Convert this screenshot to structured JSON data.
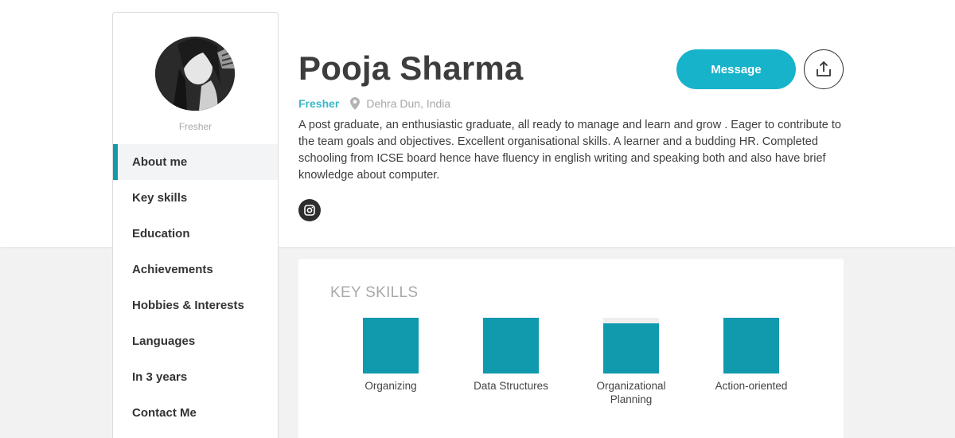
{
  "profile": {
    "name": "Pooja Sharma",
    "role": "Fresher",
    "location": "Dehra Dun, India",
    "bio": "A post graduate, an enthusiastic graduate, all ready to manage and learn and grow . Eager to contribute to the team goals and objectives. Excellent organisational skills. A learner and a budding HR. Completed schooling from ICSE board hence have fluency in english writing and speaking both and also have brief knowledge about computer.",
    "message_label": "Message"
  },
  "sidebar": {
    "role": "Fresher",
    "items": [
      {
        "label": "About me",
        "active": true
      },
      {
        "label": "Key skills",
        "active": false
      },
      {
        "label": "Education",
        "active": false
      },
      {
        "label": "Achievements",
        "active": false
      },
      {
        "label": "Hobbies & Interests",
        "active": false
      },
      {
        "label": "Languages",
        "active": false
      },
      {
        "label": "In 3 years",
        "active": false
      },
      {
        "label": "Contact Me",
        "active": false
      }
    ]
  },
  "key_skills": {
    "title": "KEY SKILLS",
    "items": [
      {
        "label": "Organizing",
        "level": 1.0
      },
      {
        "label": "Data Structures",
        "level": 1.0
      },
      {
        "label": "Organizational Planning",
        "level": 0.9
      },
      {
        "label": "Action-oriented",
        "level": 1.0
      }
    ]
  },
  "icons": {
    "location": "map-pin-icon",
    "social": "instagram-icon",
    "share": "share-icon"
  },
  "colors": {
    "accent": "#17b3cb",
    "skill_fill": "#1199ad",
    "role_text": "#3cb8c8"
  }
}
